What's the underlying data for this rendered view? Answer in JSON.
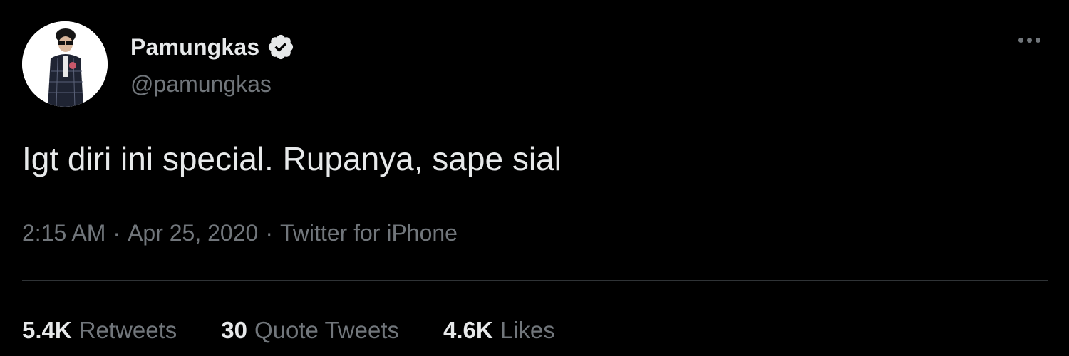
{
  "tweet": {
    "author": {
      "display_name": "Pamungkas",
      "handle": "@pamungkas",
      "verified": true,
      "verified_icon": "verified-badge-icon"
    },
    "more_icon": "more-horizontal-icon",
    "text": "Igt diri ini special. Rupanya, sape sial",
    "time": "2:15 AM",
    "date": "Apr 25, 2020",
    "separator": "·",
    "source": "Twitter for iPhone",
    "stats": {
      "retweets": {
        "count": "5.4K",
        "label": "Retweets"
      },
      "quote_tweets": {
        "count": "30",
        "label": "Quote Tweets"
      },
      "likes": {
        "count": "4.6K",
        "label": "Likes"
      }
    }
  },
  "colors": {
    "background": "#000000",
    "primary_text": "#e7e9ea",
    "secondary_text": "#71767b",
    "divider": "#2f3336"
  }
}
